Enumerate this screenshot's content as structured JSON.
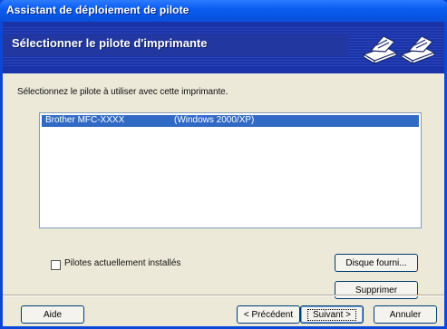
{
  "window": {
    "title": "Assistant de déploiement de pilote"
  },
  "banner": {
    "heading": "Sélectionner le pilote d'imprimante",
    "icon": "printer-icon"
  },
  "instruction": "Sélectionnez le pilote à utiliser avec cette imprimante.",
  "driver_list": {
    "rows": [
      {
        "name": "Brother  MFC-XXXX",
        "os": "(Windows 2000/XP)",
        "selected": true
      }
    ]
  },
  "checkbox": {
    "label": "Pilotes actuellement installés",
    "checked": false
  },
  "buttons": {
    "disk": "Disque fourni...",
    "delete": "Supprimer",
    "help": "Aide",
    "back": "< Précédent",
    "next": "Suivant >",
    "cancel": "Annuler"
  },
  "colors": {
    "titlebar": "#0a5df2",
    "banner": "#1b33a8",
    "selection": "#316ac5",
    "dialog": "#ece9d8"
  }
}
